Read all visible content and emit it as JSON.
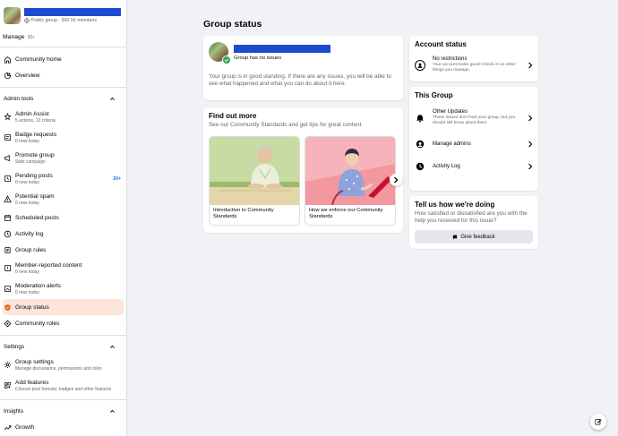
{
  "sidebar": {
    "group_meta": "Public group · 342.1K members",
    "manage_label": "Manage",
    "manage_count": "20+",
    "items_top": [
      {
        "label": "Community home",
        "icon": "home-icon"
      },
      {
        "label": "Overview",
        "icon": "overview-icon"
      }
    ],
    "admin_tools_label": "Admin tools",
    "admin_items": [
      {
        "label": "Admin Assist",
        "sub": "5 actions, 10 criteria",
        "icon": "admin-assist-icon"
      },
      {
        "label": "Badge requests",
        "sub": "0 new today",
        "icon": "badge-icon"
      },
      {
        "label": "Promote group",
        "sub": "Start campaign",
        "icon": "megaphone-icon"
      },
      {
        "label": "Pending posts",
        "sub": "0 new today",
        "icon": "pending-posts-icon",
        "badge": "20+"
      },
      {
        "label": "Potential spam",
        "sub": "0 new today",
        "icon": "warning-icon"
      },
      {
        "label": "Scheduled posts",
        "icon": "calendar-icon"
      },
      {
        "label": "Activity log",
        "icon": "clock-icon"
      },
      {
        "label": "Group rules",
        "icon": "rules-icon"
      },
      {
        "label": "Member-reported content",
        "sub": "0 new today",
        "icon": "report-icon"
      },
      {
        "label": "Moderation alerts",
        "sub": "0 new today",
        "icon": "alert-icon"
      },
      {
        "label": "Group status",
        "icon": "shield-icon",
        "active": true
      },
      {
        "label": "Community roles",
        "icon": "roles-icon"
      }
    ],
    "settings_label": "Settings",
    "settings_items": [
      {
        "label": "Group settings",
        "sub": "Manage discussions, permissions and roles",
        "icon": "gear-icon"
      },
      {
        "label": "Add features",
        "sub": "Choose post formats, badges and other features",
        "icon": "features-icon"
      }
    ],
    "insights_label": "Insights",
    "insights_items": [
      {
        "label": "Growth",
        "icon": "growth-icon"
      }
    ]
  },
  "main": {
    "title": "Group status",
    "status": {
      "line": "Group has no issues",
      "desc": "Your group is in good standing. If there are any issues, you will be able to see what happened and what you can do about it here."
    },
    "learn": {
      "title": "Find out more",
      "sub": "See our Community Standards and get tips for great content",
      "tiles": [
        {
          "caption": "Introduction to Community Standards"
        },
        {
          "caption": "How we enforce our Community Standards"
        }
      ]
    },
    "account": {
      "title": "Account status",
      "row_title": "No restrictions",
      "row_sub": "Your account looks good! Check in on other things you manage."
    },
    "this_group": {
      "title": "This Group",
      "rows": [
        {
          "title": "Other Updates",
          "sub": "These issues don't hurt your group, but you should still know about them."
        },
        {
          "title": "Manage admins",
          "sub": ""
        },
        {
          "title": "Activity Log",
          "sub": ""
        }
      ]
    },
    "feedback": {
      "title": "Tell us how we're doing",
      "sub": "How satisfied or dissatisfied are you with the help you received for this issue?",
      "button": "Give feedback"
    }
  },
  "colors": {
    "accent": "#1b74e4",
    "active_bg": "#fde5da",
    "success": "#31a24c",
    "redaction": "#1c4bd1"
  }
}
